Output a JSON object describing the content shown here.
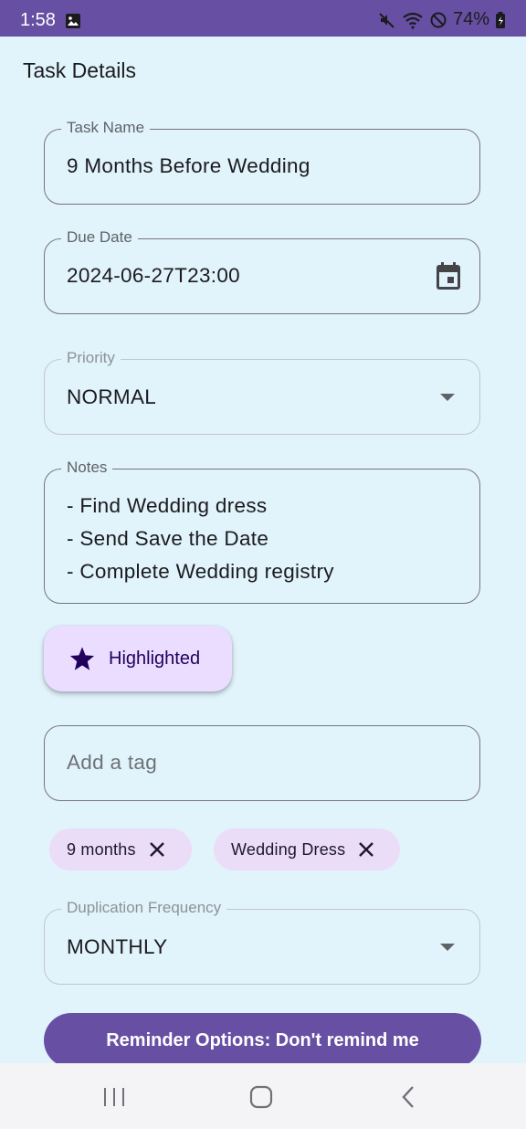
{
  "status_bar": {
    "time": "1:58",
    "battery": "74%"
  },
  "screen": {
    "title": "Task Details"
  },
  "task_name": {
    "label": "Task Name",
    "value": "9 Months Before Wedding"
  },
  "due_date": {
    "label": "Due Date",
    "value": "2024-06-27T23:00"
  },
  "priority": {
    "label": "Priority",
    "value": "NORMAL"
  },
  "notes": {
    "label": "Notes",
    "lines": [
      "- Find Wedding dress",
      "- Send Save the Date",
      "- Complete Wedding registry"
    ]
  },
  "highlight": {
    "label": "Highlighted"
  },
  "tag_input": {
    "placeholder": "Add a tag"
  },
  "tags": [
    {
      "label": "9 months"
    },
    {
      "label": "Wedding Dress"
    }
  ],
  "duplication": {
    "label": "Duplication Frequency",
    "value": "MONTHLY"
  },
  "reminder": {
    "label": "Reminder Options: Don't remind me"
  },
  "colors": {
    "accent": "#6750a4",
    "background": "#e1f3fb",
    "chip": "#ebdcf8"
  }
}
